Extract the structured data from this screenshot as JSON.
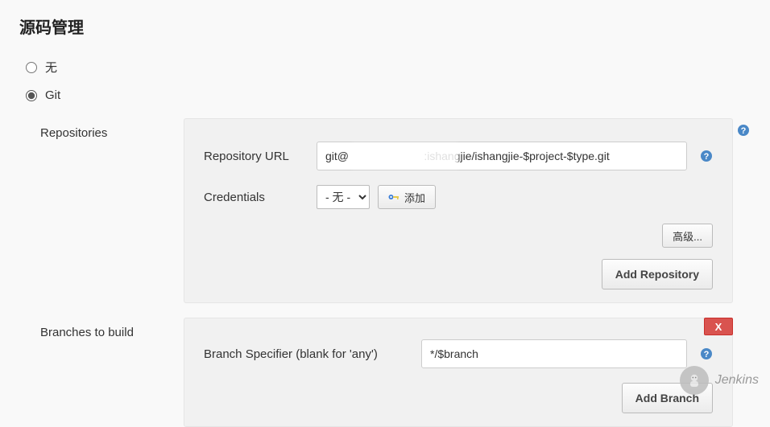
{
  "section_title": "源码管理",
  "scm_options": {
    "none_label": "无",
    "git_label": "Git"
  },
  "repositories": {
    "block_label": "Repositories",
    "url_label": "Repository URL",
    "url_value": "git@                        :ishangjie/ishangjie-$project-$type.git",
    "credentials_label": "Credentials",
    "credentials_selected": "- 无 -",
    "add_cred_label": "添加",
    "advanced_label": "高级...",
    "add_repo_label": "Add Repository"
  },
  "branches": {
    "block_label": "Branches to build",
    "specifier_label": "Branch Specifier (blank for 'any')",
    "specifier_value": "*/$branch",
    "delete_label": "X",
    "add_branch_label": "Add Branch"
  },
  "watermark": {
    "text": "Jenkins"
  }
}
